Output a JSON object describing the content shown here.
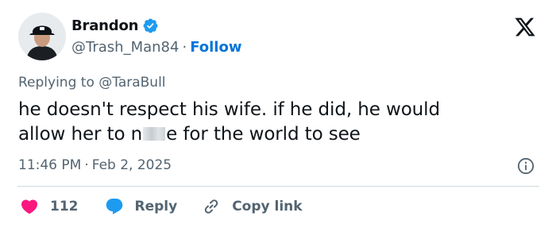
{
  "user": {
    "display_name": "Brandon",
    "handle": "@Trash_Man84",
    "separator": "·",
    "follow_label": "Follow"
  },
  "reply": {
    "prefix": "Replying to",
    "mention": "@TaraBull"
  },
  "tweet": {
    "line1": "he doesn't respect his wife.  if he did, he would",
    "line2_before": "allow her to n",
    "line2_after": "e for the world to see"
  },
  "meta": {
    "time": "11:46 PM",
    "separator": "·",
    "date": "Feb 2, 2025"
  },
  "actions": {
    "like_count": "112",
    "reply_label": "Reply",
    "copy_label": "Copy link"
  },
  "colors": {
    "like": "#f91880",
    "reply": "#1d9bf0",
    "verified": "#1d9bf0",
    "follow": "#0074d9",
    "muted": "#536471"
  },
  "icons": [
    "verified-badge-icon",
    "x-logo-icon",
    "info-icon",
    "heart-icon",
    "reply-bubble-icon",
    "link-icon"
  ]
}
